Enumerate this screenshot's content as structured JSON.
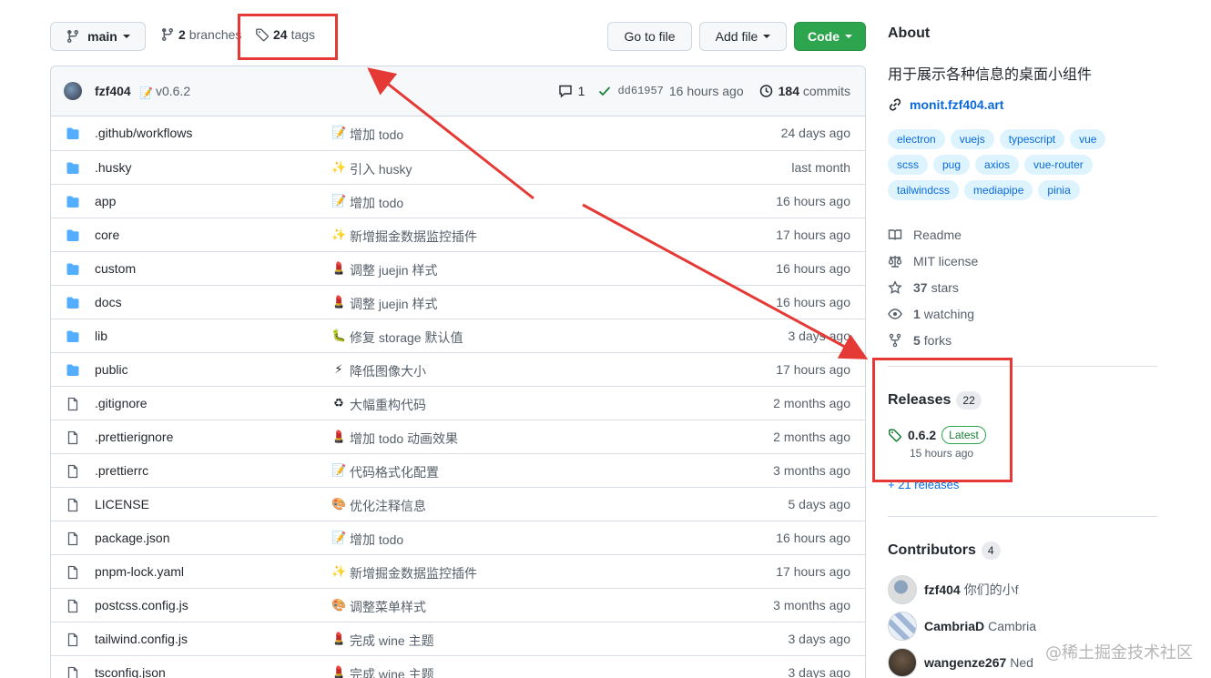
{
  "toolbar": {
    "branch": "main",
    "branches_count": "2",
    "branches_label": "branches",
    "tags_count": "24",
    "tags_label": "tags",
    "goto_label": "Go to file",
    "addfile_label": "Add file",
    "code_label": "Code"
  },
  "commit": {
    "author": "fzf404",
    "message": "v0.6.2",
    "comments": "1",
    "sha": "dd61957",
    "time": "16 hours ago",
    "commits_count": "184",
    "commits_label": "commits"
  },
  "files": [
    {
      "name": ".github/workflows",
      "type": "folder",
      "emoji": "📝",
      "msg": "增加 todo",
      "age": "24 days ago"
    },
    {
      "name": ".husky",
      "type": "folder",
      "emoji": "✨",
      "msg": "引入 husky",
      "age": "last month"
    },
    {
      "name": "app",
      "type": "folder",
      "emoji": "📝",
      "msg": "增加 todo",
      "age": "16 hours ago"
    },
    {
      "name": "core",
      "type": "folder",
      "emoji": "✨",
      "msg": "新增掘金数据监控插件",
      "age": "17 hours ago"
    },
    {
      "name": "custom",
      "type": "folder",
      "emoji": "💄",
      "msg": "调整 juejin 样式",
      "age": "16 hours ago"
    },
    {
      "name": "docs",
      "type": "folder",
      "emoji": "💄",
      "msg": "调整 juejin 样式",
      "age": "16 hours ago"
    },
    {
      "name": "lib",
      "type": "folder",
      "emoji": "🐛",
      "msg": "修复 storage 默认值",
      "age": "3 days ago"
    },
    {
      "name": "public",
      "type": "folder",
      "emoji": "⚡",
      "msg": "降低图像大小",
      "age": "17 hours ago"
    },
    {
      "name": ".gitignore",
      "type": "file",
      "emoji": "♻",
      "msg": "大幅重构代码",
      "age": "2 months ago"
    },
    {
      "name": ".prettierignore",
      "type": "file",
      "emoji": "💄",
      "msg": "增加 todo 动画效果",
      "age": "2 months ago"
    },
    {
      "name": ".prettierrc",
      "type": "file",
      "emoji": "📝",
      "msg": "代码格式化配置",
      "age": "3 months ago"
    },
    {
      "name": "LICENSE",
      "type": "file",
      "emoji": "🎨",
      "msg": "优化注释信息",
      "age": "5 days ago"
    },
    {
      "name": "package.json",
      "type": "file",
      "emoji": "📝",
      "msg": "增加 todo",
      "age": "16 hours ago"
    },
    {
      "name": "pnpm-lock.yaml",
      "type": "file",
      "emoji": "✨",
      "msg": "新增掘金数据监控插件",
      "age": "17 hours ago"
    },
    {
      "name": "postcss.config.js",
      "type": "file",
      "emoji": "🎨",
      "msg": "调整菜单样式",
      "age": "3 months ago"
    },
    {
      "name": "tailwind.config.js",
      "type": "file",
      "emoji": "💄",
      "msg": "完成 wine 主题",
      "age": "3 days ago"
    },
    {
      "name": "tsconfig.json",
      "type": "file",
      "emoji": "💄",
      "msg": "完成 wine 主题",
      "age": "3 days ago"
    }
  ],
  "about": {
    "title": "About",
    "description": "用于展示各种信息的桌面小组件",
    "homepage": "monit.fzf404.art",
    "topics": [
      "electron",
      "vuejs",
      "typescript",
      "vue",
      "scss",
      "pug",
      "axios",
      "vue-router",
      "tailwindcss",
      "mediapipe",
      "pinia"
    ],
    "readme": "Readme",
    "license": "MIT license",
    "stars_count": "37",
    "stars_label": "stars",
    "watching_count": "1",
    "watching_label": "watching",
    "forks_count": "5",
    "forks_label": "forks"
  },
  "releases": {
    "title": "Releases",
    "count": "22",
    "latest_version": "0.6.2",
    "latest_badge": "Latest",
    "latest_time": "15 hours ago",
    "more": "+ 21 releases"
  },
  "contributors": {
    "title": "Contributors",
    "count": "4",
    "list": [
      {
        "login": "fzf404",
        "name": "你们的小f"
      },
      {
        "login": "CambriaD",
        "name": "Cambria"
      },
      {
        "login": "wangenze267",
        "name": "Ned"
      }
    ]
  },
  "watermark": "@稀土掘金技术社区",
  "colors": {
    "link": "#0969da",
    "primary_button": "#2da44e",
    "annotation": "#e53935",
    "folder_icon": "#54aeff"
  }
}
